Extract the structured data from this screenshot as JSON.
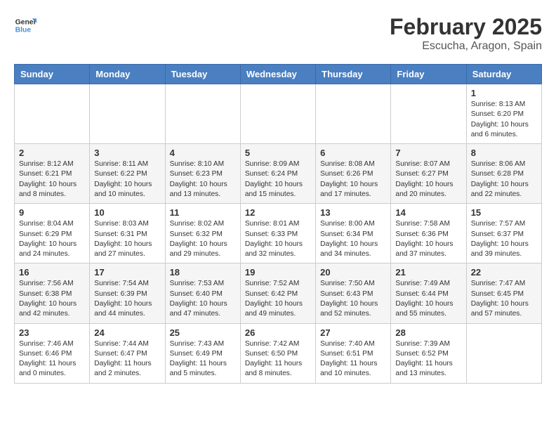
{
  "header": {
    "logo_line1": "General",
    "logo_line2": "Blue",
    "title": "February 2025",
    "subtitle": "Escucha, Aragon, Spain"
  },
  "weekdays": [
    "Sunday",
    "Monday",
    "Tuesday",
    "Wednesday",
    "Thursday",
    "Friday",
    "Saturday"
  ],
  "weeks": [
    [
      {
        "day": "",
        "info": ""
      },
      {
        "day": "",
        "info": ""
      },
      {
        "day": "",
        "info": ""
      },
      {
        "day": "",
        "info": ""
      },
      {
        "day": "",
        "info": ""
      },
      {
        "day": "",
        "info": ""
      },
      {
        "day": "1",
        "info": "Sunrise: 8:13 AM\nSunset: 6:20 PM\nDaylight: 10 hours\nand 6 minutes."
      }
    ],
    [
      {
        "day": "2",
        "info": "Sunrise: 8:12 AM\nSunset: 6:21 PM\nDaylight: 10 hours\nand 8 minutes."
      },
      {
        "day": "3",
        "info": "Sunrise: 8:11 AM\nSunset: 6:22 PM\nDaylight: 10 hours\nand 10 minutes."
      },
      {
        "day": "4",
        "info": "Sunrise: 8:10 AM\nSunset: 6:23 PM\nDaylight: 10 hours\nand 13 minutes."
      },
      {
        "day": "5",
        "info": "Sunrise: 8:09 AM\nSunset: 6:24 PM\nDaylight: 10 hours\nand 15 minutes."
      },
      {
        "day": "6",
        "info": "Sunrise: 8:08 AM\nSunset: 6:26 PM\nDaylight: 10 hours\nand 17 minutes."
      },
      {
        "day": "7",
        "info": "Sunrise: 8:07 AM\nSunset: 6:27 PM\nDaylight: 10 hours\nand 20 minutes."
      },
      {
        "day": "8",
        "info": "Sunrise: 8:06 AM\nSunset: 6:28 PM\nDaylight: 10 hours\nand 22 minutes."
      }
    ],
    [
      {
        "day": "9",
        "info": "Sunrise: 8:04 AM\nSunset: 6:29 PM\nDaylight: 10 hours\nand 24 minutes."
      },
      {
        "day": "10",
        "info": "Sunrise: 8:03 AM\nSunset: 6:31 PM\nDaylight: 10 hours\nand 27 minutes."
      },
      {
        "day": "11",
        "info": "Sunrise: 8:02 AM\nSunset: 6:32 PM\nDaylight: 10 hours\nand 29 minutes."
      },
      {
        "day": "12",
        "info": "Sunrise: 8:01 AM\nSunset: 6:33 PM\nDaylight: 10 hours\nand 32 minutes."
      },
      {
        "day": "13",
        "info": "Sunrise: 8:00 AM\nSunset: 6:34 PM\nDaylight: 10 hours\nand 34 minutes."
      },
      {
        "day": "14",
        "info": "Sunrise: 7:58 AM\nSunset: 6:36 PM\nDaylight: 10 hours\nand 37 minutes."
      },
      {
        "day": "15",
        "info": "Sunrise: 7:57 AM\nSunset: 6:37 PM\nDaylight: 10 hours\nand 39 minutes."
      }
    ],
    [
      {
        "day": "16",
        "info": "Sunrise: 7:56 AM\nSunset: 6:38 PM\nDaylight: 10 hours\nand 42 minutes."
      },
      {
        "day": "17",
        "info": "Sunrise: 7:54 AM\nSunset: 6:39 PM\nDaylight: 10 hours\nand 44 minutes."
      },
      {
        "day": "18",
        "info": "Sunrise: 7:53 AM\nSunset: 6:40 PM\nDaylight: 10 hours\nand 47 minutes."
      },
      {
        "day": "19",
        "info": "Sunrise: 7:52 AM\nSunset: 6:42 PM\nDaylight: 10 hours\nand 49 minutes."
      },
      {
        "day": "20",
        "info": "Sunrise: 7:50 AM\nSunset: 6:43 PM\nDaylight: 10 hours\nand 52 minutes."
      },
      {
        "day": "21",
        "info": "Sunrise: 7:49 AM\nSunset: 6:44 PM\nDaylight: 10 hours\nand 55 minutes."
      },
      {
        "day": "22",
        "info": "Sunrise: 7:47 AM\nSunset: 6:45 PM\nDaylight: 10 hours\nand 57 minutes."
      }
    ],
    [
      {
        "day": "23",
        "info": "Sunrise: 7:46 AM\nSunset: 6:46 PM\nDaylight: 11 hours\nand 0 minutes."
      },
      {
        "day": "24",
        "info": "Sunrise: 7:44 AM\nSunset: 6:47 PM\nDaylight: 11 hours\nand 2 minutes."
      },
      {
        "day": "25",
        "info": "Sunrise: 7:43 AM\nSunset: 6:49 PM\nDaylight: 11 hours\nand 5 minutes."
      },
      {
        "day": "26",
        "info": "Sunrise: 7:42 AM\nSunset: 6:50 PM\nDaylight: 11 hours\nand 8 minutes."
      },
      {
        "day": "27",
        "info": "Sunrise: 7:40 AM\nSunset: 6:51 PM\nDaylight: 11 hours\nand 10 minutes."
      },
      {
        "day": "28",
        "info": "Sunrise: 7:39 AM\nSunset: 6:52 PM\nDaylight: 11 hours\nand 13 minutes."
      },
      {
        "day": "",
        "info": ""
      }
    ]
  ]
}
